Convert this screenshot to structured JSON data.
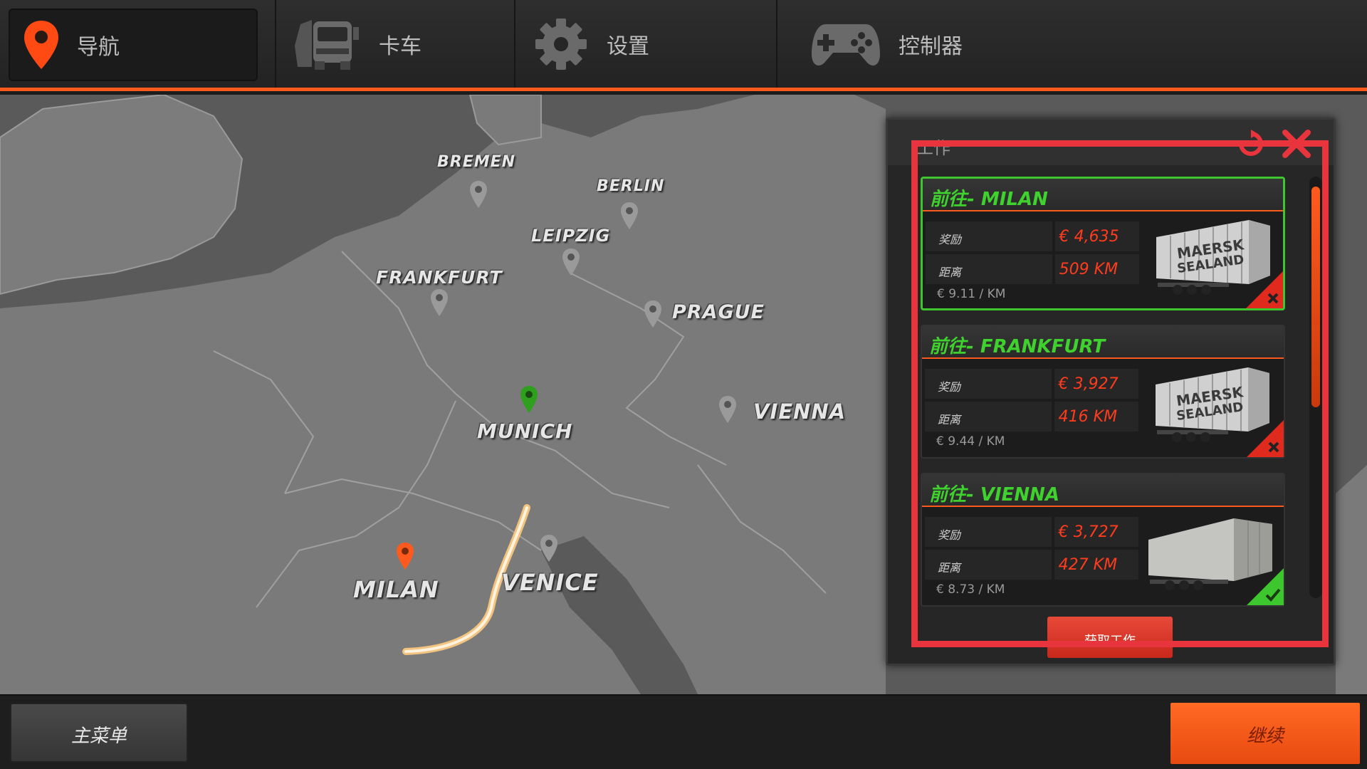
{
  "nav": {
    "tabs": [
      {
        "label": "导航",
        "icon": "map-pin-icon"
      },
      {
        "label": "卡车",
        "icon": "truck-icon"
      },
      {
        "label": "设置",
        "icon": "gear-icon"
      },
      {
        "label": "控制器",
        "icon": "gamepad-icon"
      }
    ],
    "accent": "#ff5a1e"
  },
  "map": {
    "cities": [
      {
        "name": "BREMEN"
      },
      {
        "name": "BERLIN"
      },
      {
        "name": "LEIPZIG"
      },
      {
        "name": "FRANKFURT"
      },
      {
        "name": "PRAGUE"
      },
      {
        "name": "MUNICH",
        "status": "current"
      },
      {
        "name": "VIENNA"
      },
      {
        "name": "MILAN",
        "status": "destination"
      },
      {
        "name": "VENICE"
      }
    ],
    "route": {
      "from": "MUNICH",
      "to": "MILAN"
    }
  },
  "jobs_panel": {
    "title": "工作",
    "reward_label": "奖励",
    "distance_label": "距离",
    "accept_label": "获取工作",
    "jobs": [
      {
        "title": "前往- MILAN",
        "reward": "€ 4,635",
        "distance": "509 KM",
        "rate": "€ 9.11 / KM",
        "trailer": "container",
        "available": false,
        "selected": true
      },
      {
        "title": "前往- FRANKFURT",
        "reward": "€ 3,927",
        "distance": "416 KM",
        "rate": "€ 9.44 / KM",
        "trailer": "container",
        "available": false,
        "selected": false
      },
      {
        "title": "前往- VIENNA",
        "reward": "€ 3,727",
        "distance": "427 KM",
        "rate": "€ 8.73 / KM",
        "trailer": "curtain",
        "available": true,
        "selected": false
      }
    ]
  },
  "bottom": {
    "main_menu_label": "主菜单",
    "continue_label": "继续"
  }
}
